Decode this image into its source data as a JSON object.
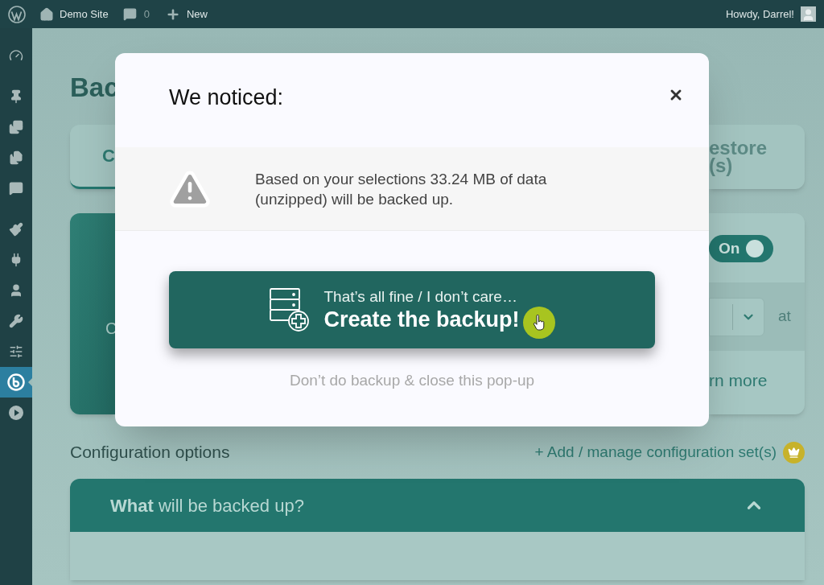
{
  "admin_bar": {
    "site": "Demo Site",
    "comments": "0",
    "new": "New",
    "greeting": "Howdy, Darrel!"
  },
  "sidebar": {
    "groups": [
      {
        "items": [
          {
            "selected": false
          }
        ]
      },
      {
        "items": [
          {
            "selected": false
          },
          {
            "selected": false
          },
          {
            "selected": false
          },
          {
            "selected": false
          }
        ]
      },
      {
        "items": [
          {
            "selected": false
          },
          {
            "selected": false
          },
          {
            "selected": false
          },
          {
            "selected": false
          },
          {
            "selected": false
          },
          {
            "selected": true
          },
          {
            "selected": false
          }
        ]
      }
    ]
  },
  "page": {
    "title": "Bac",
    "tab_left": "C",
    "tab_right": [
      "estore",
      "(s)"
    ]
  },
  "schedule_card": {
    "left_letter": "C",
    "toggle": {
      "label": "On",
      "on": true
    },
    "at": "at",
    "learn_more": "rn more"
  },
  "config": {
    "heading": "Configuration options",
    "link": "+ Add / manage configuration set(s)"
  },
  "accordion": {
    "title": "**What** will be backed up?",
    "expanded": true
  },
  "modal": {
    "title": "We noticed:",
    "message": "Based on your selections 33.24 MB of data (unzipped) will be backed up.",
    "confirm": {
      "line1": "That’s all fine / I don’t care…",
      "line2": "Create the backup!"
    },
    "dismiss": "Don’t do backup & close this pop-up"
  }
}
